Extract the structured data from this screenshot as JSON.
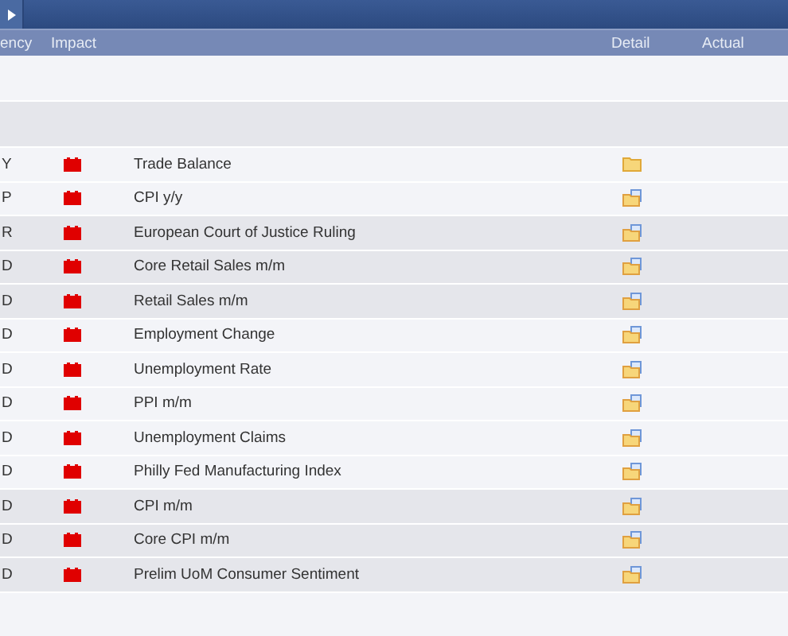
{
  "columns": [
    "ency",
    "Impact",
    "Detail",
    "Actual"
  ],
  "days": [
    {
      "kind": "blank"
    },
    {
      "kind": "blank"
    },
    {
      "kind": "events",
      "rows": [
        {
          "currency": "Y",
          "color": "#e00000",
          "event": "Trade Balance",
          "kind": "folder"
        },
        {
          "currency": "P",
          "color": "#e00000",
          "event": "CPI y/y",
          "kind": "folder-doc"
        }
      ]
    },
    {
      "kind": "events",
      "rows": [
        {
          "currency": "R",
          "color": "#e00000",
          "event": "European Court of Justice Ruling",
          "kind": "folder-doc"
        },
        {
          "currency": "D",
          "color": "#e00000",
          "event": "Core Retail Sales m/m",
          "kind": "folder-doc"
        },
        {
          "currency": "D",
          "color": "#e00000",
          "event": "Retail Sales m/m",
          "kind": "folder-doc"
        }
      ]
    },
    {
      "kind": "events",
      "rows": [
        {
          "currency": "D",
          "color": "#e00000",
          "event": "Employment Change",
          "kind": "folder-doc"
        },
        {
          "currency": "D",
          "color": "#e00000",
          "event": "Unemployment Rate",
          "kind": "folder-doc"
        },
        {
          "currency": "D",
          "color": "#e00000",
          "event": "PPI m/m",
          "kind": "folder-doc"
        },
        {
          "currency": "D",
          "color": "#e00000",
          "event": "Unemployment Claims",
          "kind": "folder-doc"
        },
        {
          "currency": "D",
          "color": "#e00000",
          "event": "Philly Fed Manufacturing Index",
          "kind": "folder-doc"
        }
      ]
    },
    {
      "kind": "events",
      "rows": [
        {
          "currency": "D",
          "color": "#e00000",
          "event": "CPI m/m",
          "kind": "folder-doc"
        },
        {
          "currency": "D",
          "color": "#e00000",
          "event": "Core CPI m/m",
          "kind": "folder-doc"
        },
        {
          "currency": "D",
          "color": "#e00000",
          "event": "Prelim UoM Consumer Sentiment",
          "kind": "folder-doc"
        }
      ]
    }
  ]
}
